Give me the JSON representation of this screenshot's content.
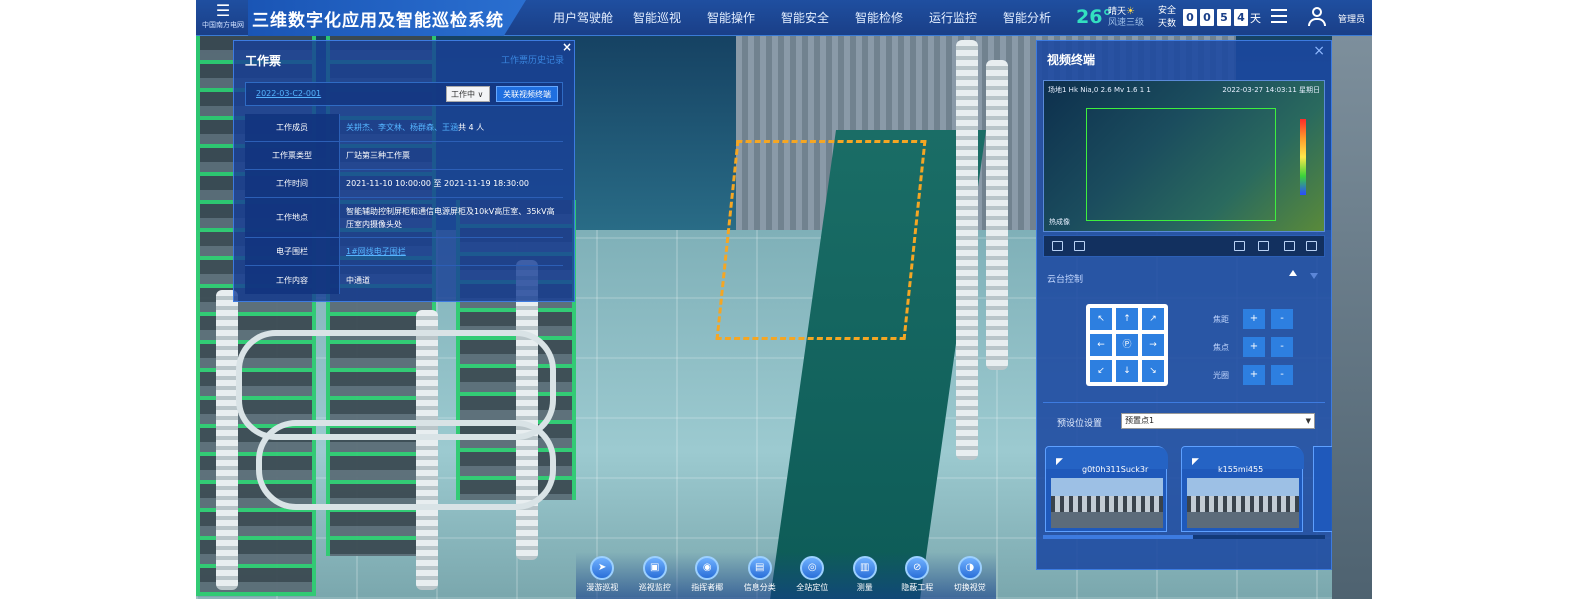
{
  "app": {
    "title": "三维数字化应用及智能巡检系统",
    "logo_text": "中国南方电网"
  },
  "nav": {
    "items": [
      "用户驾驶舱",
      "智能巡视",
      "智能操作",
      "智能安全",
      "智能检修",
      "运行监控",
      "智能分析"
    ]
  },
  "status": {
    "temperature": "26°",
    "weather": "晴天",
    "wind": "风速三级",
    "safe_label_1": "安全",
    "safe_label_2": "天数",
    "safe_digits": [
      "0",
      "0",
      "5",
      "4"
    ],
    "safe_unit": "天",
    "user": "管理员"
  },
  "ticket": {
    "title": "工作票",
    "history_link": "工作票历史记录",
    "close": "×",
    "id": "2022-03-C2-001",
    "status": "工作中",
    "link_video_button": "关联视频终端",
    "rows": [
      {
        "label": "工作成员",
        "value_links": "关耕杰、李文林、杨群森、王涵",
        "value_suffix": " 共 4 人"
      },
      {
        "label": "工作票类型",
        "value": "厂站第三种工作票"
      },
      {
        "label": "工作时间",
        "value": "2021-11-10 10:00:00 至 2021-11-19 18:30:00"
      },
      {
        "label": "工作地点",
        "value": "智能辅助控制屏柜和通信电源屏柜及10kV高压室、35kV高压室内摄像头处"
      },
      {
        "label": "电子围栏",
        "value_link": "1#网线电子围栏"
      },
      {
        "label": "工作内容",
        "value": "中通道"
      }
    ]
  },
  "video": {
    "title": "视频终端",
    "close": "×",
    "osd_left": "场地1 Hk Nia,0 2.6 Mv 1.6 1 1",
    "osd_time": "2022-03-27 14:03:11 星期日",
    "osd_label": "热成像",
    "ptz_title": "云台控制",
    "ptz_arrows": [
      "↖",
      "↑",
      "↗",
      "←",
      "Ⓟ",
      "→",
      "↙",
      "↓",
      "↘"
    ],
    "ptz_side": [
      {
        "label": "焦距",
        "plus": "+",
        "minus": "-"
      },
      {
        "label": "焦点",
        "plus": "+",
        "minus": "-"
      },
      {
        "label": "光圈",
        "plus": "+",
        "minus": "-"
      }
    ],
    "preset_label": "预设位设置",
    "preset_value": "预置点1",
    "cameras": [
      {
        "name": "g0t0h311Suck3r"
      },
      {
        "name": "k155mi455"
      }
    ]
  },
  "toolbar": {
    "items": [
      {
        "label": "漫游巡视",
        "icon": "roam-icon"
      },
      {
        "label": "巡视监控",
        "icon": "monitor-icon"
      },
      {
        "label": "指挥者椰",
        "icon": "command-icon"
      },
      {
        "label": "信息分类",
        "icon": "info-icon"
      },
      {
        "label": "全站定位",
        "icon": "locate-icon"
      },
      {
        "label": "测量",
        "icon": "measure-icon"
      },
      {
        "label": "隐蔽工程",
        "icon": "hidden-icon"
      },
      {
        "label": "切换视觉",
        "icon": "switch-view-icon"
      }
    ]
  }
}
